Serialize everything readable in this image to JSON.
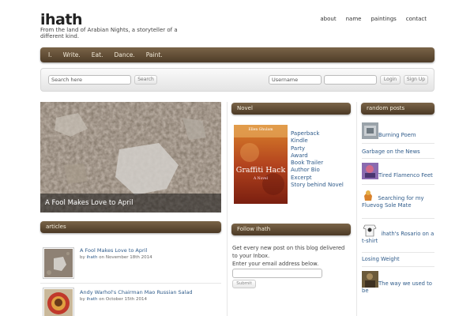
{
  "site": {
    "title": "ihath",
    "tagline": "From the land of Arabian Nights, a storyteller of a different kind."
  },
  "top_nav": [
    "about",
    "name",
    "paintings",
    "contact"
  ],
  "main_nav": [
    "I.",
    "Write.",
    "Eat.",
    "Dance.",
    "Paint."
  ],
  "search": {
    "placeholder": "Search here",
    "button": "Search",
    "username_placeholder": "Username",
    "login_button": "Login",
    "signup_button": "Sign Up"
  },
  "hero": {
    "caption": "A Fool Makes Love to April"
  },
  "articles": {
    "heading": "articles",
    "items": [
      {
        "title": "A Fool Makes Love to April",
        "author": "ihath",
        "date_prefix": "on November 18th 2014"
      },
      {
        "title": "Andy Warhol's Chairman Mao Russian Salad",
        "author": "ihath",
        "date_prefix": "on October 15th 2014"
      }
    ]
  },
  "novel": {
    "heading": "Novel",
    "book": {
      "author": "Ellen Ghulam",
      "title": "Graffiti Hack",
      "subtitle": "A Novel"
    },
    "links": [
      "Paperback",
      "Kindle",
      "Party",
      "Award",
      "Book Trailer",
      "Author Bio",
      "Excerpt",
      "Story behind Novel"
    ]
  },
  "follow": {
    "heading": "Follow Ihath",
    "text": "Get every new post on this blog delivered to your Inbox.",
    "email_label": "Enter your email address below.",
    "submit": "Submit"
  },
  "random_posts": {
    "heading": "random posts",
    "items": [
      "Burning Poem",
      "Garbage on the News",
      "Tired Flamenco Feet",
      "Searching for my Fluevog Sole Mate",
      "ihath's Rosario on a t-shirt",
      "Losing Weight",
      "The way we used to be"
    ]
  },
  "colors": {
    "nav_bar": "#5a4630",
    "link": "#2f5b8a"
  }
}
